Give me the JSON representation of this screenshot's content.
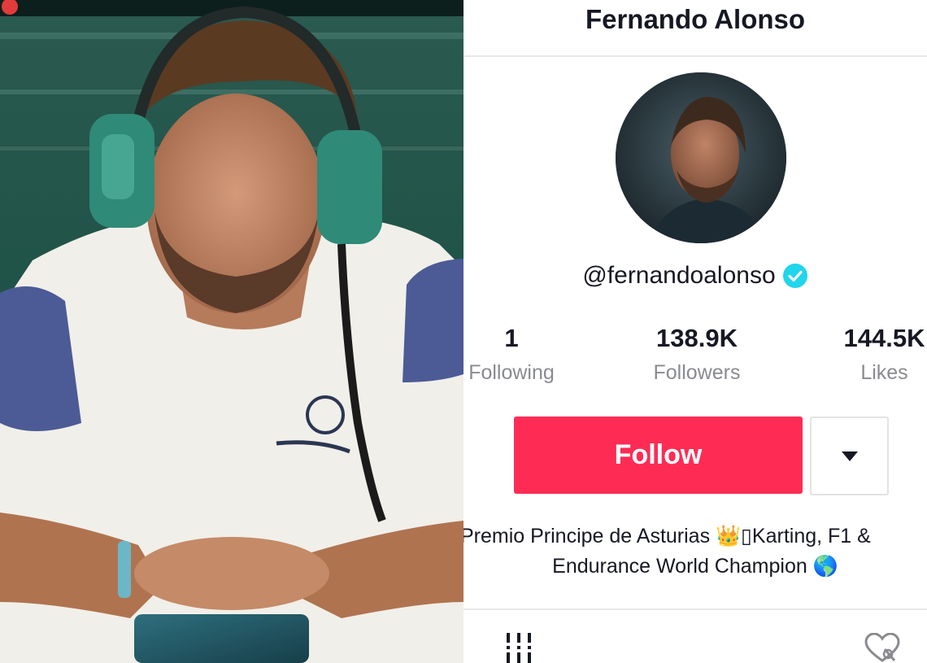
{
  "profile": {
    "display_name": "Fernando Alonso",
    "handle": "@fernandoalonso",
    "verified": true,
    "stats": [
      {
        "value": "1",
        "label": "Following"
      },
      {
        "value": "138.9K",
        "label": "Followers"
      },
      {
        "value": "144.5K",
        "label": "Likes"
      }
    ],
    "follow_label": "Follow",
    "bio_line1": "Premio Principe de Asturias 👑▯Karting, F1 & ",
    "bio_line2": "Endurance World Champion 🌎"
  },
  "icons": {
    "verified": "verified-badge-icon",
    "dropdown": "caret-down-icon",
    "videos_tab": "grid-icon",
    "liked_tab": "hidden-heart-icon"
  },
  "colors": {
    "accent": "#fe2c55",
    "verified": "#20d5ec",
    "text": "#161823",
    "muted": "#8a8b91"
  }
}
